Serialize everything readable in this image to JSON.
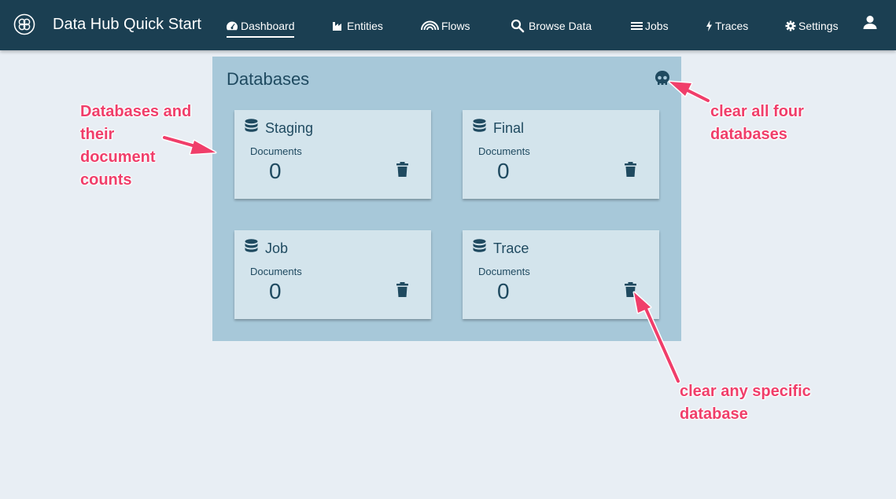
{
  "header": {
    "app_title": "Data Hub Quick Start",
    "nav": [
      {
        "label": "Dashboard",
        "icon": "dashboard-gauge-icon",
        "active": true
      },
      {
        "label": "Entities",
        "icon": "factory-icon",
        "active": false
      },
      {
        "label": "Flows",
        "icon": "flows-arc-icon",
        "active": false
      },
      {
        "label": "Browse Data",
        "icon": "search-icon",
        "active": false
      },
      {
        "label": "Jobs",
        "icon": "list-icon",
        "active": false
      },
      {
        "label": "Traces",
        "icon": "bolt-icon",
        "active": false
      },
      {
        "label": "Settings",
        "icon": "gear-icon",
        "active": false
      }
    ],
    "user_icon": "user-icon"
  },
  "databases": {
    "title": "Databases",
    "clear_all_icon": "skull-icon",
    "cards": [
      {
        "name": "Staging",
        "doc_label": "Documents",
        "count": "0"
      },
      {
        "name": "Final",
        "doc_label": "Documents",
        "count": "0"
      },
      {
        "name": "Job",
        "doc_label": "Documents",
        "count": "0"
      },
      {
        "name": "Trace",
        "doc_label": "Documents",
        "count": "0"
      }
    ]
  },
  "annotations": {
    "databases_counts": [
      "Databases and",
      "their",
      "document",
      "counts"
    ],
    "clear_all": [
      "clear all four",
      "databases"
    ],
    "clear_specific": [
      "clear any specific",
      "database"
    ]
  },
  "colors": {
    "header_bg": "#1b3f52",
    "page_bg": "#e8eef4",
    "panel_bg": "#a7c8d9",
    "card_bg": "#d3e4ec",
    "text_dark": "#1f4a60",
    "annotation": "#f03e6a"
  }
}
